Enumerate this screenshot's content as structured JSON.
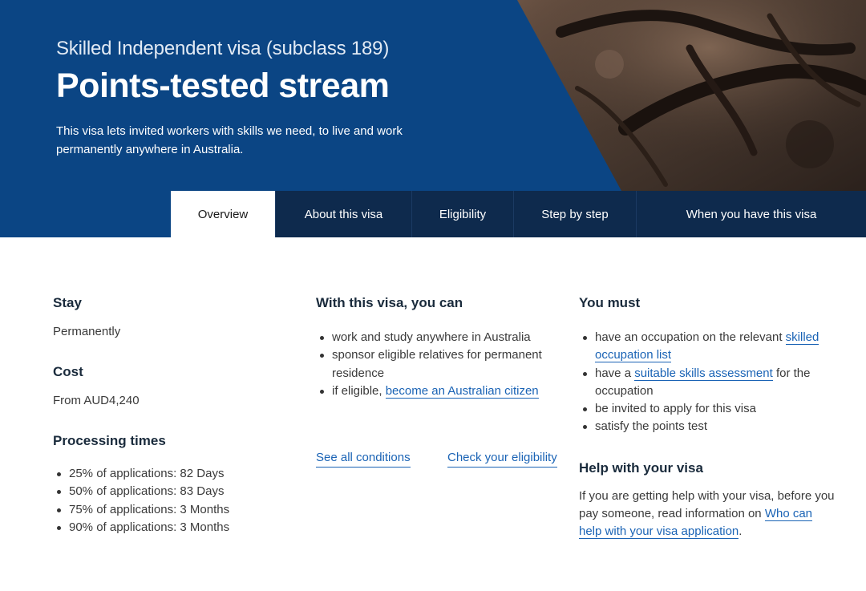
{
  "hero": {
    "subtitle": "Skilled Independent visa (subclass 189)",
    "title": "Points-tested stream",
    "description": "This visa lets invited workers with skills we need, to live and work permanently anywhere in Australia."
  },
  "tabs": [
    {
      "label": "Overview",
      "active": true
    },
    {
      "label": "About this visa",
      "active": false
    },
    {
      "label": "Eligibility",
      "active": false
    },
    {
      "label": "Step by step",
      "active": false
    },
    {
      "label": "When you have this visa",
      "active": false
    }
  ],
  "stay": {
    "heading": "Stay",
    "value": "Permanently"
  },
  "cost": {
    "heading": "Cost",
    "value": "From AUD4,240"
  },
  "processing": {
    "heading": "Processing times",
    "items": [
      "25% of applications: 82 Days",
      "50% of applications: 83 Days",
      "75% of applications: 3 Months",
      "90% of applications: 3 Months"
    ]
  },
  "with_visa": {
    "heading": "With this visa, you can",
    "item1": "work and study anywhere in Australia",
    "item2": "sponsor eligible relatives for permanent residence",
    "item3_prefix": "if eligible, ",
    "item3_link": "become an Australian citizen"
  },
  "links": {
    "see_all_conditions": "See all conditions",
    "check_eligibility": "Check your eligibility"
  },
  "you_must": {
    "heading": "You must",
    "item1_prefix": "have an occupation on the relevant ",
    "item1_link": "skilled occupation list",
    "item2_prefix": "have a ",
    "item2_link": "suitable skills assessment",
    "item2_suffix": " for the occupation",
    "item3": "be invited to apply for this visa",
    "item4": "satisfy the points test"
  },
  "help": {
    "heading": "Help with your visa",
    "text_prefix": "If you are getting help with your visa, before you pay someone, read information on ",
    "link": "Who can help with your visa application",
    "text_suffix": "."
  },
  "colors": {
    "hero_blue": "#0b4584",
    "tab_dark": "#0e2a4d",
    "link_blue": "#1a63b5",
    "heading": "#1a2b3c"
  }
}
